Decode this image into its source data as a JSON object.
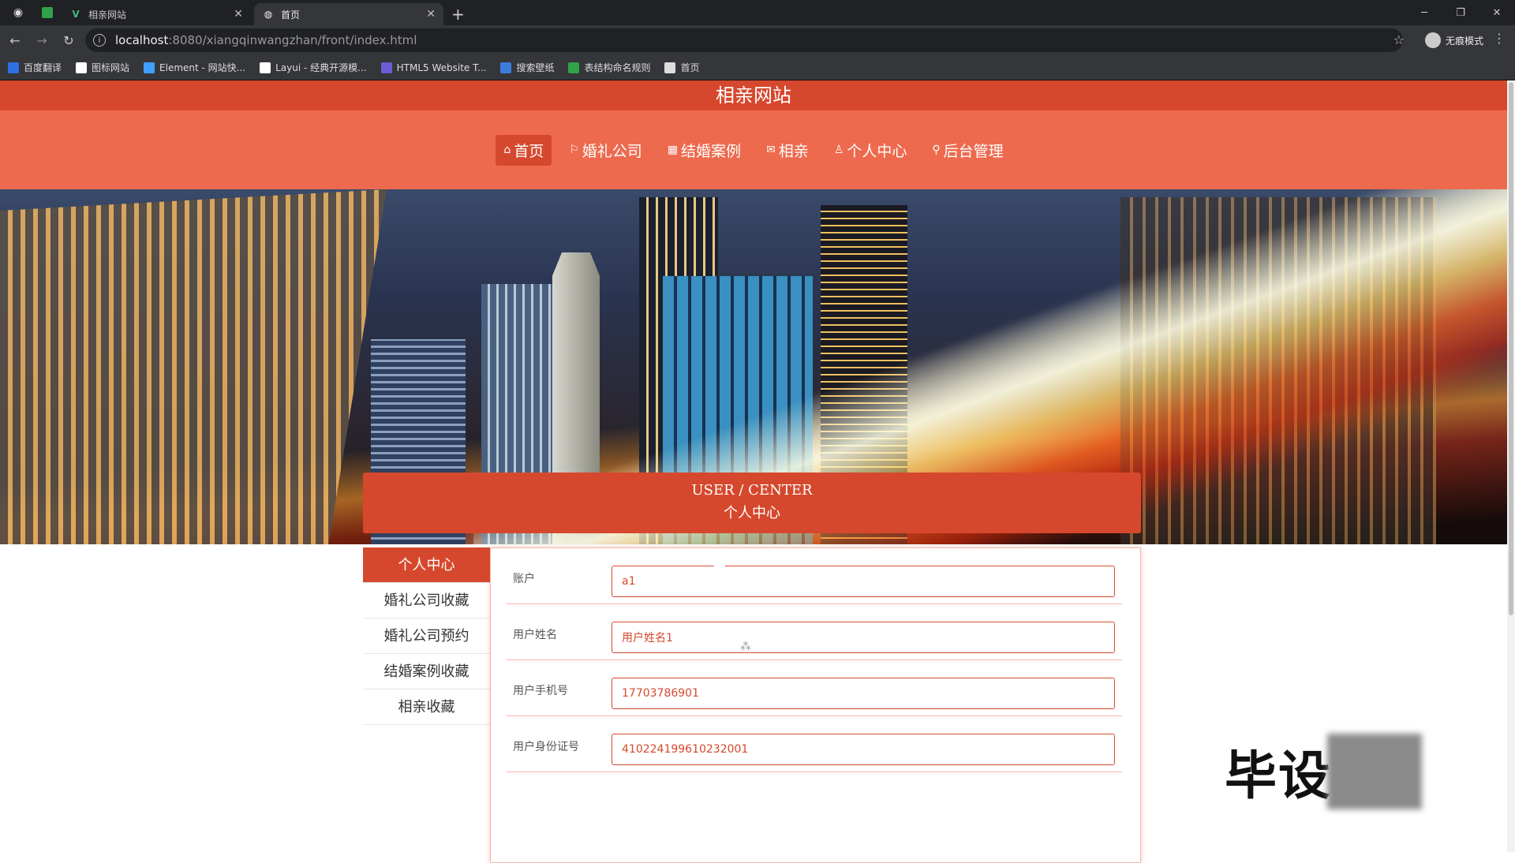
{
  "browser": {
    "tabs": [
      {
        "title": "相亲网站",
        "active": false
      },
      {
        "title": "首页",
        "active": true
      }
    ],
    "address": {
      "host": "localhost",
      "path": ":8080/xiangqinwangzhan/front/index.html"
    },
    "profile_label": "无痕模式",
    "bookmarks": [
      {
        "label": "百度翻译",
        "color": "#2f6fe4"
      },
      {
        "label": "图标网站",
        "color": "#ffffff"
      },
      {
        "label": "Element - 网站快...",
        "color": "#409eff"
      },
      {
        "label": "Layui - 经典开源模...",
        "color": "#ffffff"
      },
      {
        "label": "HTML5 Website T...",
        "color": "#6b5cd6"
      },
      {
        "label": "搜索壁纸",
        "color": "#3b7ddd"
      },
      {
        "label": "表结构命名规则",
        "color": "#2fa24a"
      },
      {
        "label": "首页",
        "color": "#dddddd"
      }
    ]
  },
  "site": {
    "title": "相亲网站",
    "nav": [
      {
        "icon": "home-icon",
        "glyph": "⌂",
        "label": "首页",
        "active": true
      },
      {
        "icon": "flag-icon",
        "glyph": "⚐",
        "label": "婚礼公司",
        "active": false
      },
      {
        "icon": "gift-icon",
        "glyph": "▦",
        "label": "结婚案例",
        "active": false
      },
      {
        "icon": "mail-icon",
        "glyph": "✉",
        "label": "相亲",
        "active": false
      },
      {
        "icon": "user-icon",
        "glyph": "♙",
        "label": "个人中心",
        "active": false
      },
      {
        "icon": "link-icon",
        "glyph": "⚲",
        "label": "后台管理",
        "active": false
      }
    ],
    "banner_dots": 3
  },
  "user_center": {
    "title_en": "USER / CENTER",
    "title_cn": "个人中心",
    "menu": [
      {
        "label": "个人中心",
        "active": true
      },
      {
        "label": "婚礼公司收藏",
        "active": false
      },
      {
        "label": "婚礼公司预约",
        "active": false
      },
      {
        "label": "结婚案例收藏",
        "active": false
      },
      {
        "label": "相亲收藏",
        "active": false
      }
    ],
    "fields": [
      {
        "label": "账户",
        "value": "a1"
      },
      {
        "label": "用户姓名",
        "value": "用户姓名1"
      },
      {
        "label": "用户手机号",
        "value": "17703786901"
      },
      {
        "label": "用户身份证号",
        "value": "410224199610232001"
      }
    ]
  },
  "overlay": {
    "watermark_text": "毕设"
  }
}
